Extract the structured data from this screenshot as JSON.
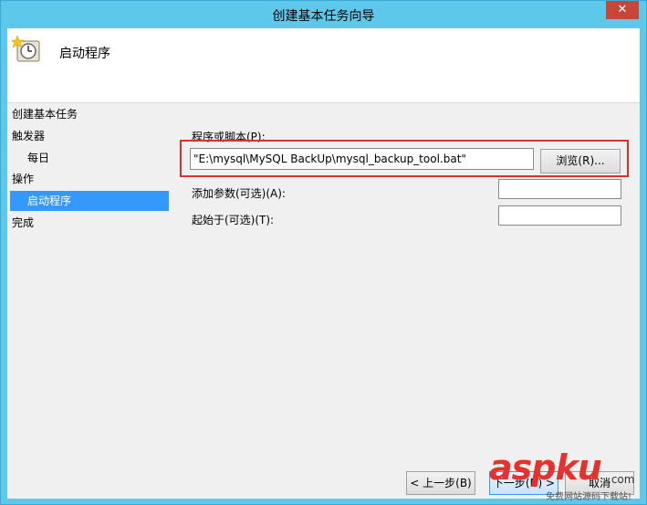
{
  "window": {
    "title": "创建基本任务向导",
    "close_glyph": "✕"
  },
  "header": {
    "title": "启动程序",
    "icon": "clock-icon"
  },
  "nav": {
    "items": [
      {
        "label": "创建基本任务"
      },
      {
        "label": "触发器"
      },
      {
        "label": "每日"
      },
      {
        "label": "操作"
      },
      {
        "label": "启动程序"
      },
      {
        "label": "完成"
      }
    ],
    "selected_color": "#3399ff"
  },
  "form": {
    "program_label": "程序或脚本(P):",
    "program_value": "\"E:\\mysql\\MySQL BackUp\\mysql_backup_tool.bat\"",
    "browse_label": "浏览(R)...",
    "args_label": "添加参数(可选)(A):",
    "args_value": "",
    "startin_label": "起始于(可选)(T):",
    "startin_value": "",
    "highlight_color": "#d9312d"
  },
  "footer": {
    "back_label": "< 上一步(B)",
    "next_label": "下一步(N) >",
    "cancel_label": "取消"
  },
  "watermark": {
    "main": "aspku",
    "suffix": ".com",
    "sub": "免费网站源码下载站!"
  }
}
